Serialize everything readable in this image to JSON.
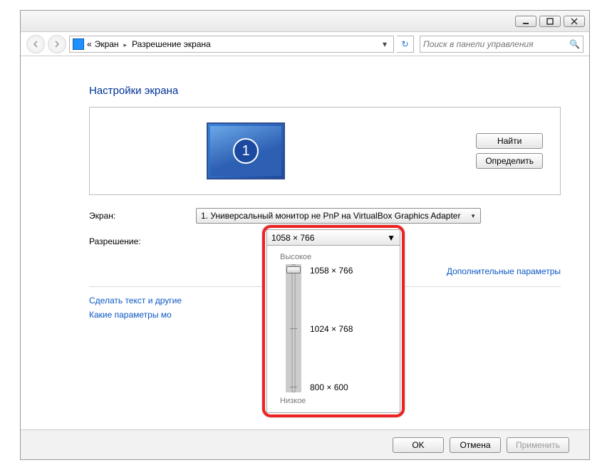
{
  "breadcrumb": {
    "prefix": "«",
    "item1": "Экран",
    "item2": "Разрешение экрана"
  },
  "search": {
    "placeholder": "Поиск в панели управления"
  },
  "heading": "Настройки экрана",
  "monitor": {
    "number": "1"
  },
  "buttons": {
    "find": "Найти",
    "identify": "Определить",
    "ok": "OK",
    "cancel": "Отмена",
    "apply": "Применить"
  },
  "labels": {
    "screen": "Экран:",
    "resolution": "Разрешение:"
  },
  "screen_combo": "1. Универсальный монитор не PnP на VirtualBox Graphics Adapter",
  "resolution_combo": "1058 × 766",
  "links": {
    "advanced": "Дополнительные параметры",
    "textsize": "Сделать текст и другие",
    "which": "Какие параметры мо"
  },
  "slider": {
    "high": "Высокое",
    "low": "Низкое",
    "opts": [
      "1058 × 766",
      "1024 × 768",
      "800 × 600"
    ]
  }
}
